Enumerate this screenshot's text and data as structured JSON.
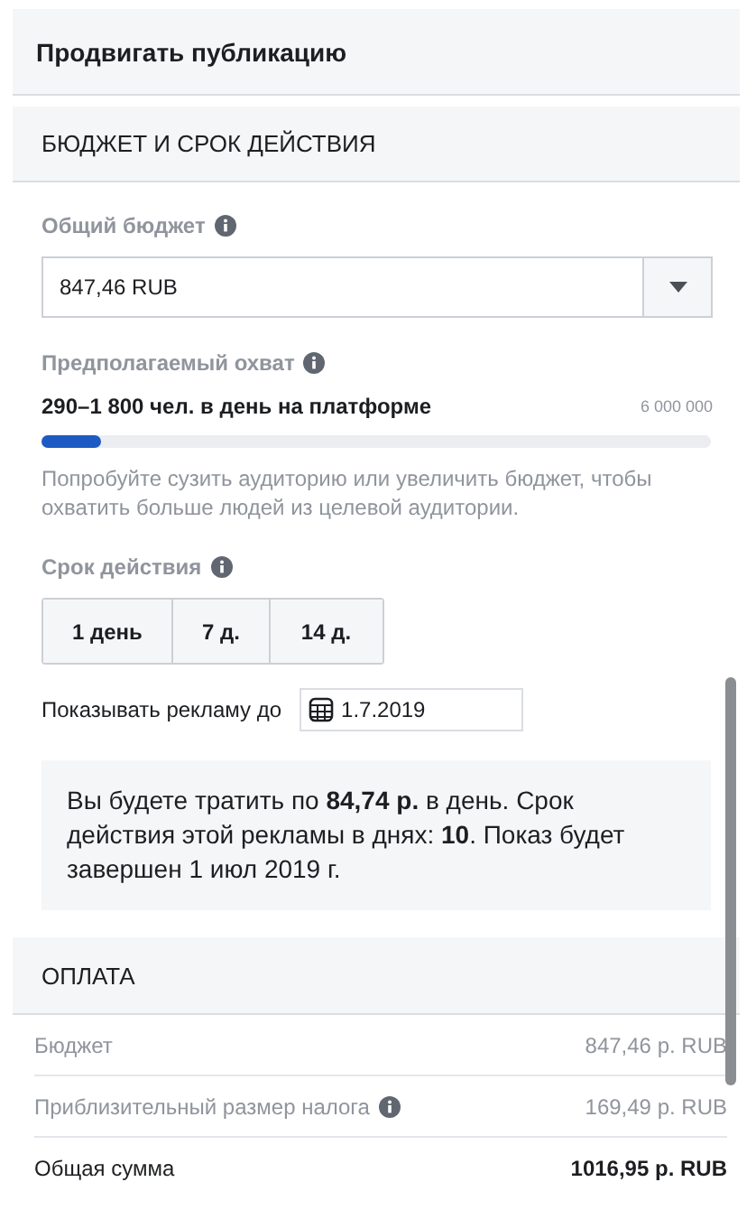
{
  "header": {
    "title": "Продвигать публикацию"
  },
  "budget_section": {
    "title": "БЮДЖЕТ И СРОК ДЕЙСТВИЯ",
    "budget": {
      "label": "Общий бюджет",
      "value": "847,46 RUB"
    },
    "reach": {
      "label": "Предполагаемый охват",
      "estimate": "290–1 800 чел. в день на платформе",
      "max": "6 000 000",
      "level": 0.09,
      "hint": "Попробуйте сузить аудиторию или увеличить бюджет, чтобы охватить больше людей из целевой аудитории."
    },
    "duration": {
      "label": "Срок действия",
      "options": [
        {
          "label": "1 день",
          "selected": false
        },
        {
          "label": "7 д.",
          "selected": false
        },
        {
          "label": "14 д.",
          "selected": false
        }
      ]
    },
    "end_date": {
      "label": "Показывать рекламу до",
      "value": "1.7.2019"
    },
    "summary": "Вы будете тратить по **84,74 р.** в день. Срок действия этой рекламы в днях: **10**. Показ будет завершен 1 июл 2019 г."
  },
  "payment": {
    "title": "ОПЛАТА",
    "rows": [
      {
        "kind": "line",
        "label": "Бюджет",
        "value": "847,46 р. RUB",
        "info": false
      },
      {
        "kind": "line",
        "label": "Приблизительный размер налога",
        "value": "169,49 р. RUB",
        "info": true
      },
      {
        "kind": "total",
        "label": "Общая сумма",
        "value": "1016,95 р. RUB",
        "info": false
      }
    ]
  }
}
